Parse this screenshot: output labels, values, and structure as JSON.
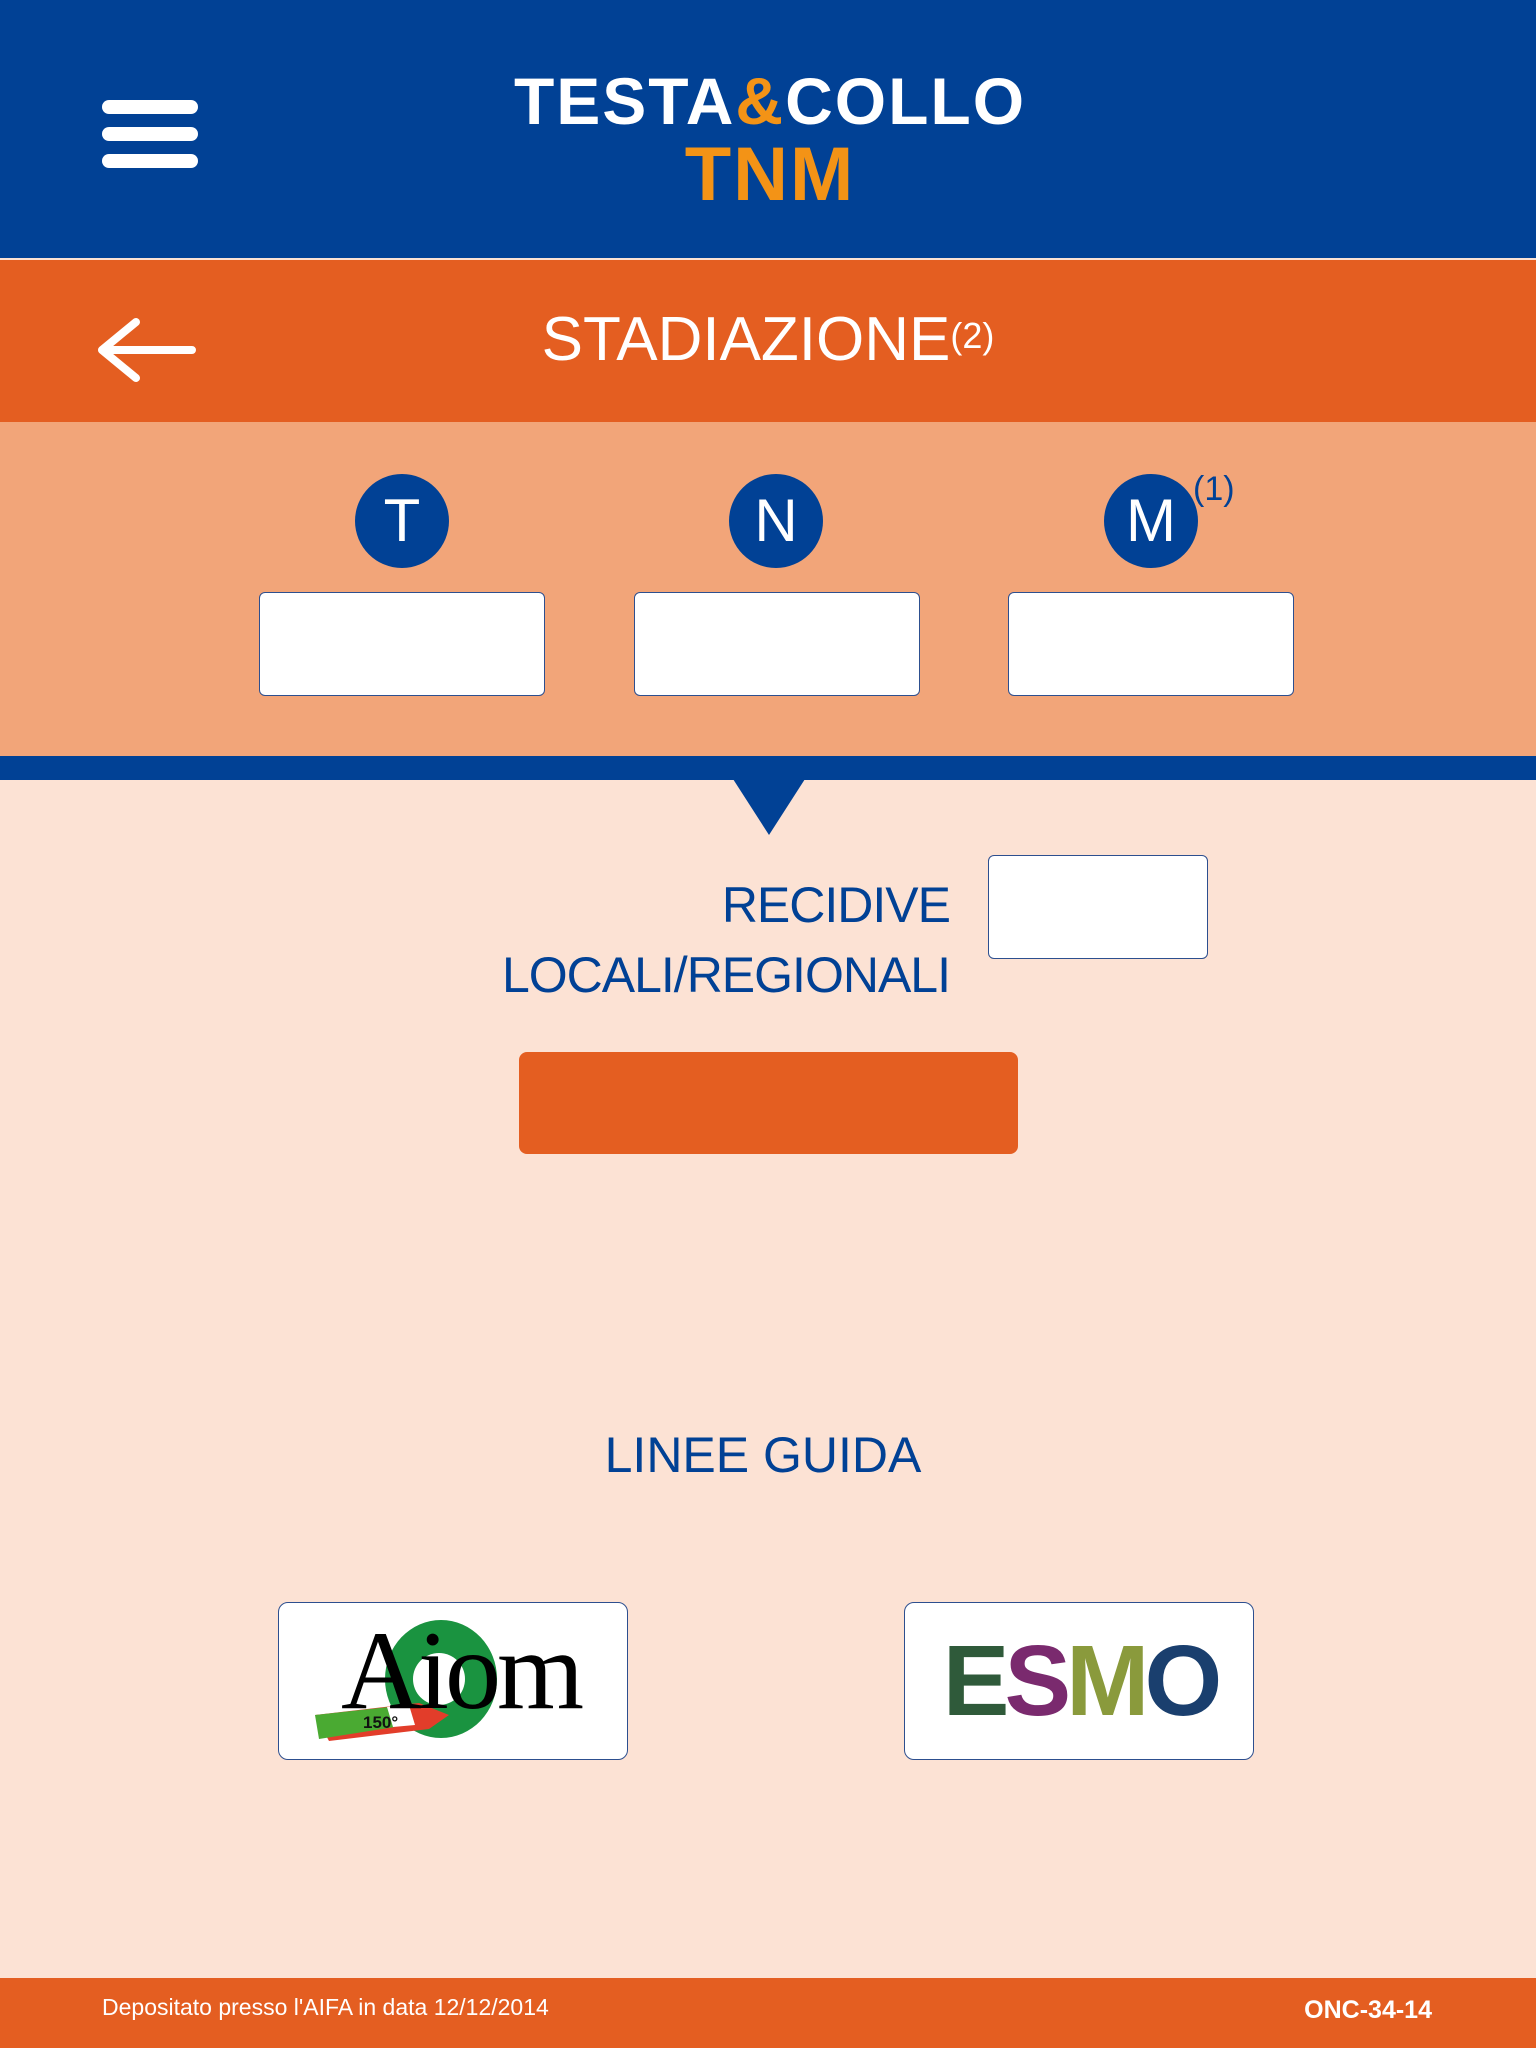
{
  "header": {
    "logo_left": "TESTA",
    "logo_amp": "&",
    "logo_right": "COLLO",
    "logo_sub": "TNM"
  },
  "titlebar": {
    "title": "STADIAZIONE",
    "title_sup": "(2)"
  },
  "staging": {
    "t_label": "T",
    "n_label": "N",
    "m_label": "M",
    "m_sup": "(1)",
    "t_value": "",
    "n_value": "",
    "m_value": ""
  },
  "recidive": {
    "label": "RECIDIVE LOCALI/REGIONALI",
    "value": ""
  },
  "guidelines": {
    "label": "LINEE GUIDA",
    "aiom_text": "Aiom",
    "aiom_badge": "150°",
    "esmo_text": "ESMO"
  },
  "footer": {
    "left": "Depositato presso l'AIFA in data 12/12/2014",
    "right": "ONC-34-14"
  },
  "colors": {
    "navy": "#014195",
    "orange": "#e45e21",
    "light_orange": "#f2a579",
    "peach": "#fce2d4",
    "logo_orange": "#f39316"
  }
}
